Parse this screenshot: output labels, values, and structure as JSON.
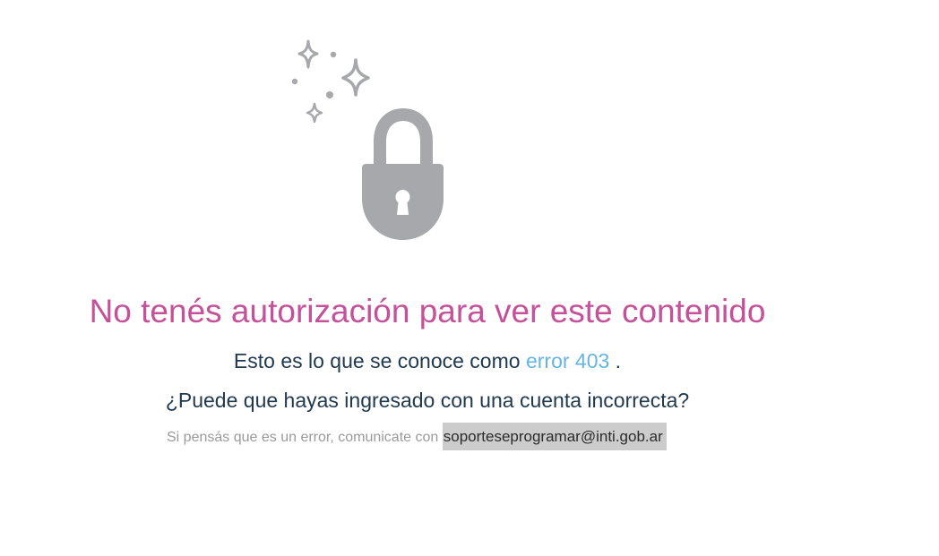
{
  "error": {
    "title": "No tenés autorización para ver este contenido",
    "line1_prefix": "Esto es lo que se conoce como",
    "line1_link": "error 403",
    "line1_suffix": ".",
    "line2": "¿Puede que hayas ingresado con una cuenta incorrecta?",
    "line3_prefix": "Si pensás que es un error, comunicate con",
    "contact_email": "soporteseprogramar@inti.gob.ar"
  },
  "icons": {
    "illustration": "padlock-with-sparkles-icon"
  },
  "colors": {
    "title": "#c4519a",
    "body_text": "#213a4f",
    "link": "#64b5e2",
    "muted_text": "#9a9a9a",
    "icon_gray": "#a7a8ab",
    "email_highlight": "#cccccc"
  }
}
